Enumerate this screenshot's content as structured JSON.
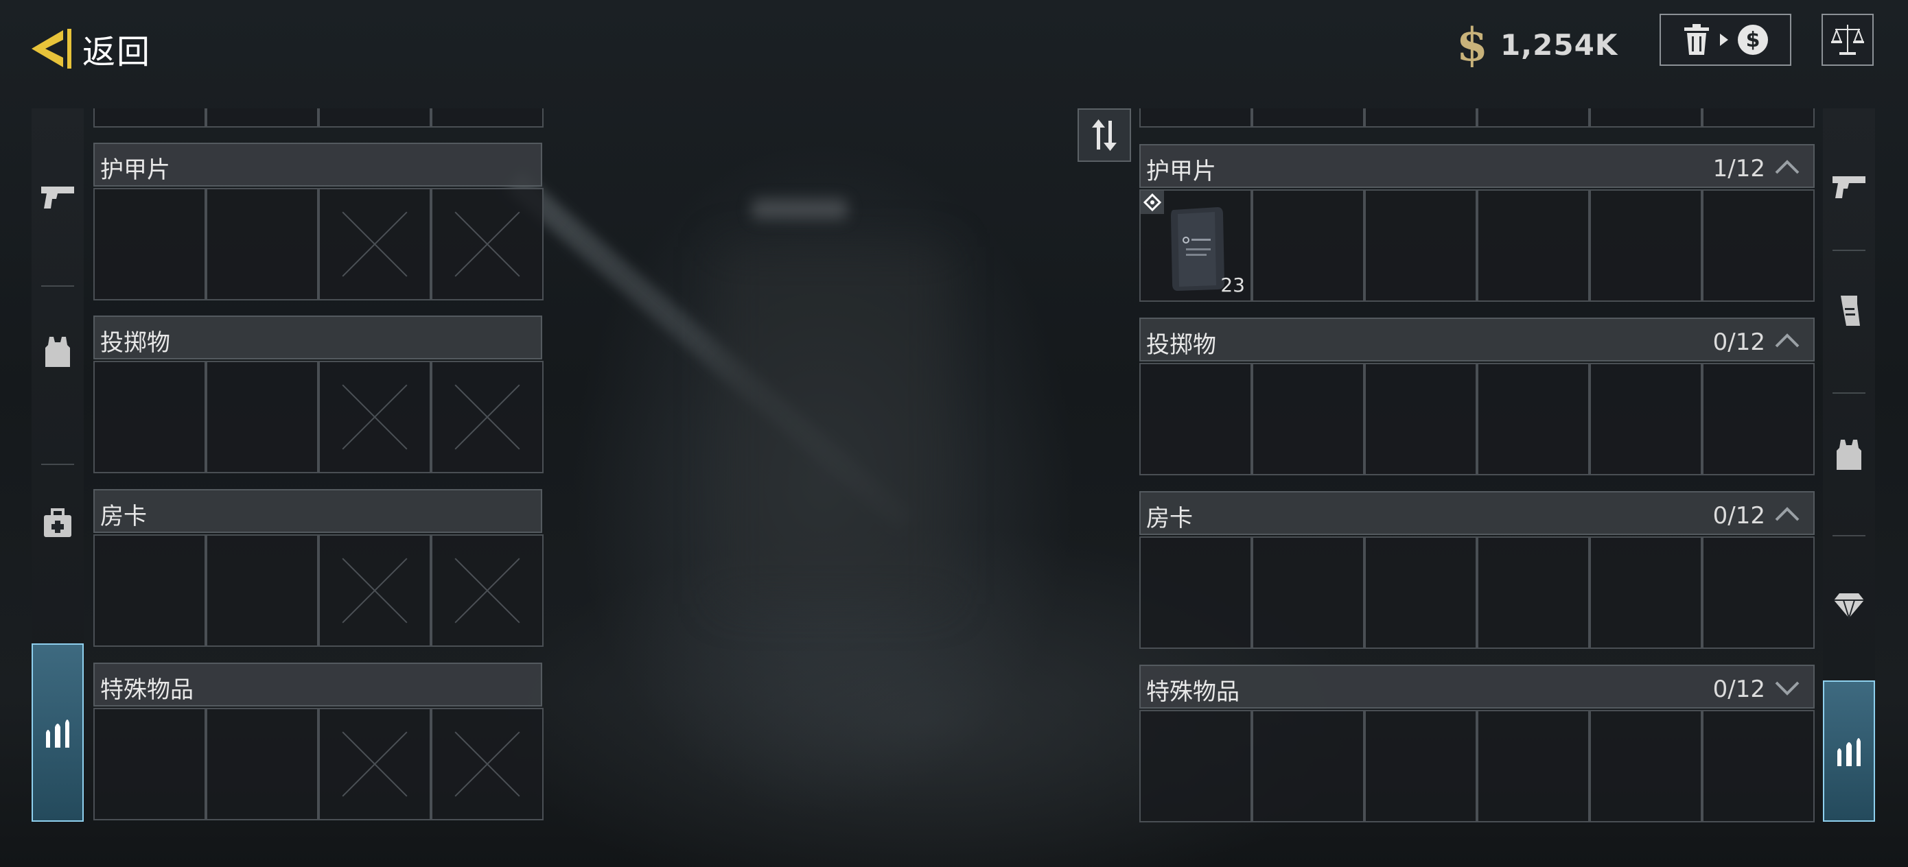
{
  "header": {
    "back_label": "返回",
    "currency_symbol": "$",
    "money": "1,254K"
  },
  "left_panel": {
    "sections": [
      {
        "title": "护甲片"
      },
      {
        "title": "投掷物"
      },
      {
        "title": "房卡"
      },
      {
        "title": "特殊物品"
      }
    ],
    "sidebar": [
      "pistol-icon",
      "vest-icon",
      "medkit-icon",
      "ammo-icon"
    ],
    "active_tab": "ammo-icon"
  },
  "right_panel": {
    "sections": [
      {
        "title": "护甲片",
        "count": "1/12",
        "expanded": true
      },
      {
        "title": "投掷物",
        "count": "0/12",
        "expanded": true
      },
      {
        "title": "房卡",
        "count": "0/12",
        "expanded": true
      },
      {
        "title": "特殊物品",
        "count": "0/12",
        "expanded": false
      }
    ],
    "item": {
      "name": "armor-plate",
      "count": "23"
    },
    "sidebar": [
      "pistol-icon",
      "magazine-icon",
      "vest-icon",
      "diamond-icon",
      "ammo-icon"
    ],
    "active_tab": "ammo-icon"
  },
  "colors": {
    "accent": "#e8c33a",
    "active_tab": "#3e6a80",
    "active_border": "#8fd0ee"
  }
}
